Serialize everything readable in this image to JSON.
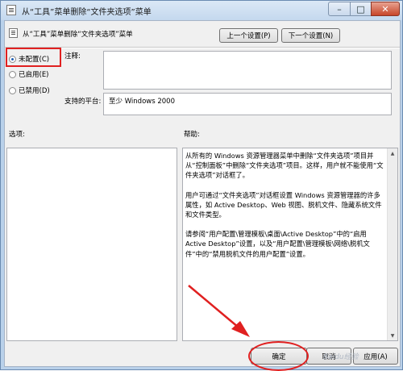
{
  "window": {
    "title": "从“工具”菜单删除“文件夹选项”菜单",
    "controls": {
      "minimize": "–",
      "maximize": "□",
      "close": "✕"
    }
  },
  "header": {
    "setting_name": "从“工具”菜单删除“文件夹选项”菜单",
    "prev_label": "上一个设置(P)",
    "next_label": "下一个设置(N)"
  },
  "state": {
    "options": [
      "未配置(C)",
      "已启用(E)",
      "已禁用(D)"
    ],
    "selected": "未配置(C)"
  },
  "comment": {
    "label": "注释:",
    "value": ""
  },
  "platform": {
    "label": "支持的平台:",
    "value": "至少 Windows 2000"
  },
  "panes": {
    "options_label": "选项:",
    "help_label": "帮助:"
  },
  "help_paragraphs": [
    "从所有的 Windows 资源管理器菜单中删除“文件夹选项”项目并从“控制面板”中删除“文件夹选项”项目。这样，用户就不能使用“文件夹选项”对话框了。",
    "用户可通过“文件夹选项”对话框设置 Windows 资源管理器的许多属性，如 Active Desktop、Web 视图、脱机文件、隐藏系统文件和文件类型。",
    "请参阅“用户配置\\管理模板\\桌面\\Active Desktop”中的“启用 Active Desktop”设置，以及“用户配置\\管理模板\\网络\\脱机文件”中的“禁用脱机文件的用户配置”设置。"
  ],
  "footer": {
    "ok_label": "确定",
    "cancel_label": "取消",
    "apply_label": "应用(A)"
  },
  "watermark": "Baidu经验",
  "colors": {
    "annotation": "#e02020",
    "accent": "#1f5fb4"
  }
}
